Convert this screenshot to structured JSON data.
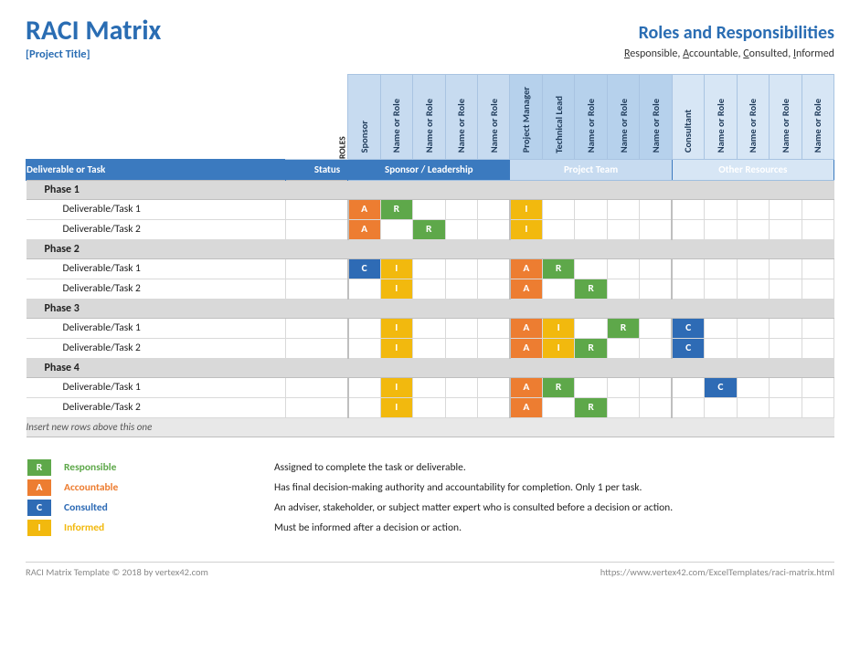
{
  "header": {
    "title": "RACI Matrix",
    "subtitle": "[Project Title]",
    "right_title": "Roles and Responsibilities",
    "right_sub_html": "Responsible, Accountable, Consulted, Informed"
  },
  "labels": {
    "roles": "ROLES",
    "deliverable_or_task": "Deliverable or Task",
    "status": "Status",
    "insert_hint": "Insert new rows above this one"
  },
  "groups": [
    {
      "name": "Sponsor / Leadership",
      "roles": [
        "Sponsor",
        "Name or Role",
        "Name or Role",
        "Name or Role",
        "Name or Role"
      ]
    },
    {
      "name": "Project Team",
      "roles": [
        "Project Manager",
        "Technical Lead",
        "Name or Role",
        "Name or Role",
        "Name or Role"
      ]
    },
    {
      "name": "Other Resources",
      "roles": [
        "Consultant",
        "Name or Role",
        "Name or Role",
        "Name or Role",
        "Name or Role"
      ]
    }
  ],
  "phases": [
    {
      "name": "Phase 1",
      "tasks": [
        {
          "name": "Deliverable/Task 1",
          "status": "",
          "cells": [
            "A",
            "R",
            "",
            "",
            "",
            "I",
            "",
            "",
            "",
            "",
            "",
            "",
            "",
            "",
            ""
          ]
        },
        {
          "name": "Deliverable/Task 2",
          "status": "",
          "cells": [
            "A",
            "",
            "R",
            "",
            "",
            "I",
            "",
            "",
            "",
            "",
            "",
            "",
            "",
            "",
            ""
          ]
        }
      ]
    },
    {
      "name": "Phase 2",
      "tasks": [
        {
          "name": "Deliverable/Task 1",
          "status": "",
          "cells": [
            "C",
            "I",
            "",
            "",
            "",
            "A",
            "R",
            "",
            "",
            "",
            "",
            "",
            "",
            "",
            ""
          ]
        },
        {
          "name": "Deliverable/Task 2",
          "status": "",
          "cells": [
            "",
            "I",
            "",
            "",
            "",
            "A",
            "",
            "R",
            "",
            "",
            "",
            "",
            "",
            "",
            ""
          ]
        }
      ]
    },
    {
      "name": "Phase 3",
      "tasks": [
        {
          "name": "Deliverable/Task 1",
          "status": "",
          "cells": [
            "",
            "I",
            "",
            "",
            "",
            "A",
            "I",
            "",
            "R",
            "",
            "C",
            "",
            "",
            "",
            ""
          ]
        },
        {
          "name": "Deliverable/Task 2",
          "status": "",
          "cells": [
            "",
            "I",
            "",
            "",
            "",
            "A",
            "I",
            "R",
            "",
            "",
            "C",
            "",
            "",
            "",
            ""
          ]
        }
      ]
    },
    {
      "name": "Phase 4",
      "tasks": [
        {
          "name": "Deliverable/Task 1",
          "status": "",
          "cells": [
            "",
            "I",
            "",
            "",
            "",
            "A",
            "R",
            "",
            "",
            "",
            "",
            "C",
            "",
            "",
            ""
          ]
        },
        {
          "name": "Deliverable/Task 2",
          "status": "",
          "cells": [
            "",
            "I",
            "",
            "",
            "",
            "A",
            "",
            "R",
            "",
            "",
            "",
            "",
            "",
            "",
            ""
          ]
        }
      ]
    }
  ],
  "legend": [
    {
      "code": "R",
      "name": "Responsible",
      "desc": "Assigned to complete the task or deliverable."
    },
    {
      "code": "A",
      "name": "Accountable",
      "desc": "Has final decision-making authority and accountability for completion. Only 1 per task."
    },
    {
      "code": "C",
      "name": "Consulted",
      "desc": "An adviser, stakeholder, or subject matter expert who is consulted before a decision or action."
    },
    {
      "code": "I",
      "name": "Informed",
      "desc": "Must be informed after a decision or action."
    }
  ],
  "footer": {
    "left": "RACI Matrix Template © 2018 by vertex42.com",
    "right": "https://www.vertex42.com/ExcelTemplates/raci-matrix.html"
  }
}
